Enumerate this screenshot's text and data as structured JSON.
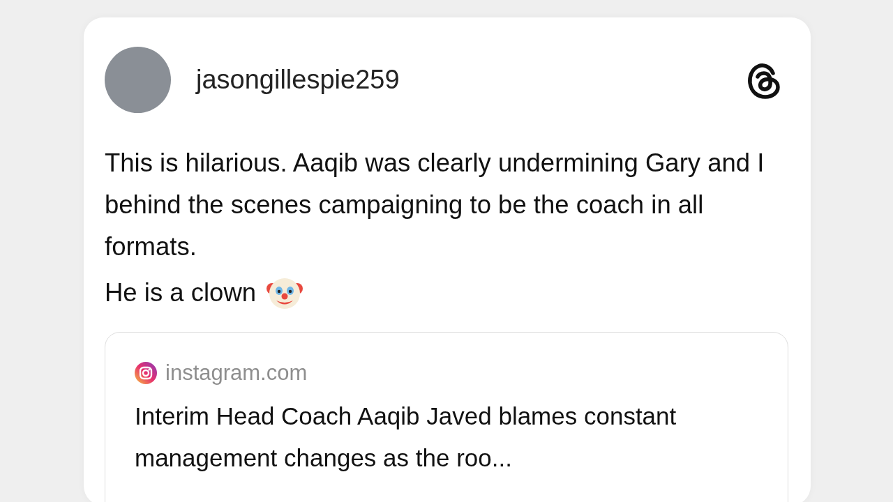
{
  "post": {
    "username": "jasongillespie259",
    "text": "This is hilarious. Aaqib was clearly undermining Gary and I behind the scenes campaigning to be the coach in all formats.",
    "second_line": "He is a clown",
    "link_preview": {
      "domain": "instagram.com",
      "title": "Interim Head Coach Aaqib Javed blames constant management changes as the roo..."
    }
  }
}
